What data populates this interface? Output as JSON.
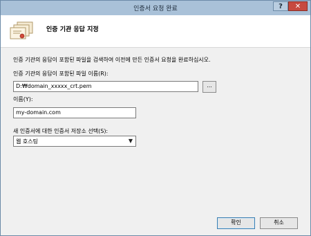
{
  "window": {
    "title": "인증서 요청 완료",
    "help_label": "?",
    "close_label": "✕"
  },
  "header": {
    "title": "인증 기관 응답 지정",
    "icon": "certificate-icon"
  },
  "form": {
    "instruction": "인증 기관의 응답이 포함된 파일을 검색하여 이전에 만든 인증서 요청을 완료하십시오.",
    "file_label": "인증 기관의 응답이 포함된 파일 이름(R):",
    "file_value": "D:₩domain_xxxxx_crt.pem",
    "browse_label": "...",
    "name_label": "이름(Y):",
    "name_value": "my-domain.com",
    "store_label": "새 인증서에 대한 인증서 저장소 선택(S):",
    "store_value": "웹 호스팅"
  },
  "buttons": {
    "ok": "확인",
    "cancel": "취소"
  }
}
